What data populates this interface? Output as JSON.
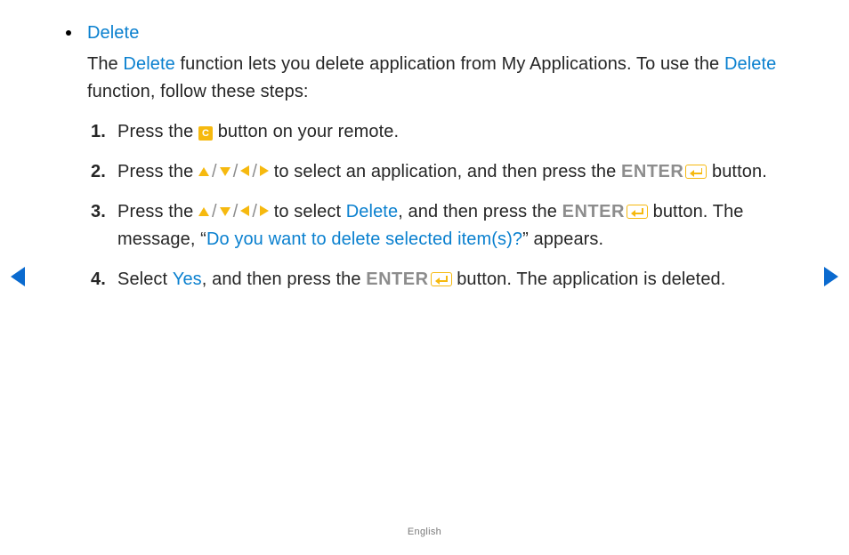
{
  "heading": "Delete",
  "intro": {
    "t1": "The ",
    "kw1": "Delete",
    "t2": " function lets you delete application from My Applications. To use the ",
    "kw2": "Delete",
    "t3": " function, follow these steps:"
  },
  "labels": {
    "enter": "ENTER",
    "c_button": "C",
    "slash": "/"
  },
  "steps": {
    "s1": {
      "a": "Press the ",
      "b": " button on your remote."
    },
    "s2": {
      "a": "Press the ",
      "b": " to select an application, and then press the ",
      "c": " button."
    },
    "s3": {
      "a": "Press the ",
      "b": " to select ",
      "kw": "Delete",
      "c": ", and then press the ",
      "d": " button. The message, “",
      "msg": "Do you want to delete selected item(s)?",
      "e": "” appears."
    },
    "s4": {
      "a": "Select ",
      "kw": "Yes",
      "b": ", and then press the ",
      "c": " button. The application is deleted."
    }
  },
  "footer": "English"
}
